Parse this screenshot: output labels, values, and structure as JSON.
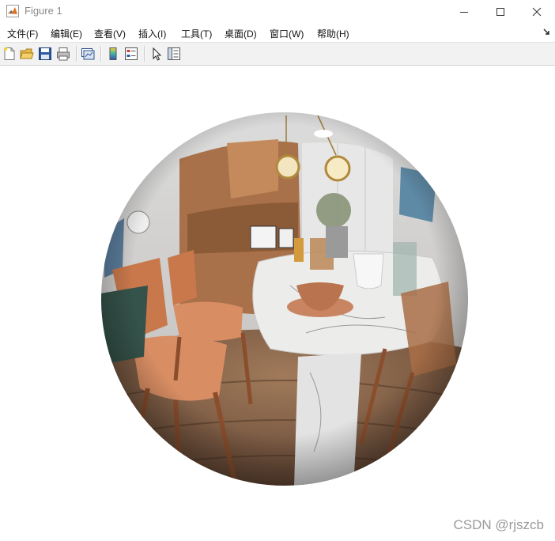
{
  "window": {
    "title": "Figure 1",
    "icon": "matlab-logo-icon"
  },
  "menu": [
    {
      "label": "文件(F)"
    },
    {
      "label": "编辑(E)"
    },
    {
      "label": "查看(V)"
    },
    {
      "label": "插入(I)"
    },
    {
      "label": "工具(T)"
    },
    {
      "label": "桌面(D)"
    },
    {
      "label": "窗口(W)"
    },
    {
      "label": "帮助(H)"
    }
  ],
  "toolbar": [
    "new-figure-icon",
    "open-file-icon",
    "save-icon",
    "print-icon",
    "link-plot-icon",
    "colorbar-icon",
    "legend-icon",
    "edit-plot-icon",
    "property-inspector-icon"
  ],
  "figure": {
    "content": "fisheye-distorted interior photo of a dining nook with chairs and a round marble table"
  },
  "watermark": "CSDN @rjszcb"
}
